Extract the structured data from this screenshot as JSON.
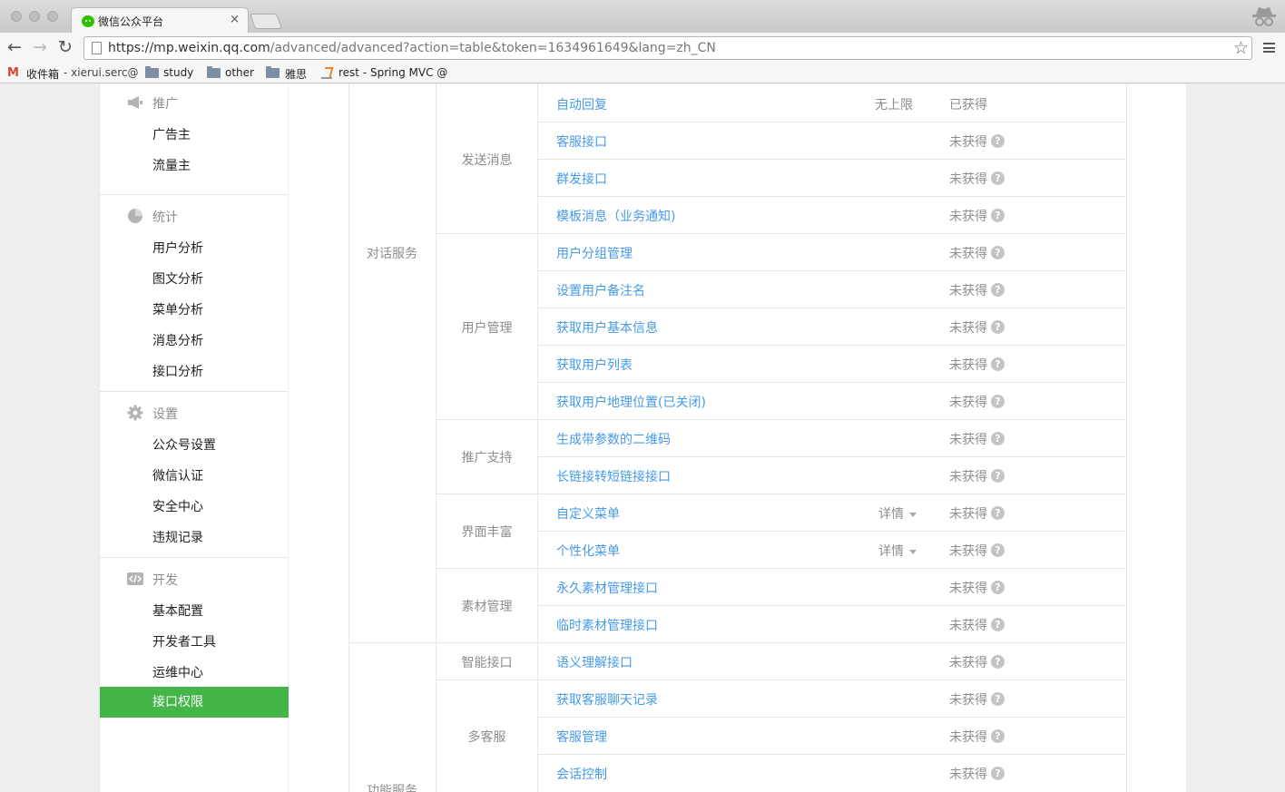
{
  "browser": {
    "tab_title": "微信公众平台",
    "tab_close": "×",
    "url_host": "https://mp.weixin.qq.com",
    "url_path": "/advanced/advanced?action=table&token=1634961649&lang=zh_CN",
    "back": "←",
    "forward": "→",
    "reload": "↻",
    "star": "☆",
    "bookmarks": [
      {
        "label": "收件箱",
        "icon": "gmail-icon"
      },
      {
        "label": "- xierui.serc@",
        "icon": ""
      },
      {
        "label": "study",
        "icon": "folder-icon"
      },
      {
        "label": "other",
        "icon": "folder-icon"
      },
      {
        "label": "雅思",
        "icon": "folder-icon"
      },
      {
        "label": "rest - Spring MVC @",
        "icon": "stackoverflow-icon"
      }
    ]
  },
  "sidebar": {
    "groups": [
      {
        "title": "推广",
        "icon": "megaphone-icon",
        "items": [
          "广告主",
          "流量主"
        ]
      },
      {
        "title": "统计",
        "icon": "pie-chart-icon",
        "items": [
          "用户分析",
          "图文分析",
          "菜单分析",
          "消息分析",
          "接口分析"
        ]
      },
      {
        "title": "设置",
        "icon": "gear-icon",
        "items": [
          "公众号设置",
          "微信认证",
          "安全中心",
          "违规记录"
        ]
      },
      {
        "title": "开发",
        "icon": "code-icon",
        "items": [
          "基本配置",
          "开发者工具",
          "运维中心",
          "接口权限"
        ]
      }
    ],
    "active_item": "接口权限",
    "active_color": "#44b549"
  },
  "table": {
    "categories": [
      {
        "name": "对话服务",
        "subcategories": [
          {
            "name": "发送消息",
            "rows": [
              {
                "api": "自动回复",
                "limit": "无上限",
                "status": "已获得",
                "help": false
              },
              {
                "api": "客服接口",
                "status": "未获得",
                "help": true
              },
              {
                "api": "群发接口",
                "status": "未获得",
                "help": true
              },
              {
                "api": "模板消息（业务通知)",
                "status": "未获得",
                "help": true
              }
            ]
          },
          {
            "name": "用户管理",
            "rows": [
              {
                "api": "用户分组管理",
                "status": "未获得",
                "help": true
              },
              {
                "api": "设置用户备注名",
                "status": "未获得",
                "help": true
              },
              {
                "api": "获取用户基本信息",
                "status": "未获得",
                "help": true
              },
              {
                "api": "获取用户列表",
                "status": "未获得",
                "help": true
              },
              {
                "api": "获取用户地理位置(已关闭)",
                "status": "未获得",
                "help": true
              }
            ]
          },
          {
            "name": "推广支持",
            "rows": [
              {
                "api": "生成带参数的二维码",
                "status": "未获得",
                "help": true
              },
              {
                "api": "长链接转短链接接口",
                "status": "未获得",
                "help": true
              }
            ]
          },
          {
            "name": "界面丰富",
            "rows": [
              {
                "api": "自定义菜单",
                "detail": "详情",
                "status": "未获得",
                "help": true
              },
              {
                "api": "个性化菜单",
                "detail": "详情",
                "status": "未获得",
                "help": true
              }
            ]
          },
          {
            "name": "素材管理",
            "rows": [
              {
                "api": "永久素材管理接口",
                "status": "未获得",
                "help": true
              },
              {
                "api": "临时素材管理接口",
                "status": "未获得",
                "help": true
              }
            ]
          }
        ]
      },
      {
        "name": "功能服务",
        "subcategories": [
          {
            "name": "智能接口",
            "rows": [
              {
                "api": "语义理解接口",
                "status": "未获得",
                "help": true
              }
            ]
          },
          {
            "name": "多客服",
            "rows": [
              {
                "api": "获取客服聊天记录",
                "status": "未获得",
                "help": true
              },
              {
                "api": "客服管理",
                "status": "未获得",
                "help": true
              },
              {
                "api": "会话控制",
                "status": "未获得",
                "help": true
              }
            ]
          }
        ]
      }
    ],
    "help_glyph": "?",
    "link_color": "#459ae9"
  }
}
